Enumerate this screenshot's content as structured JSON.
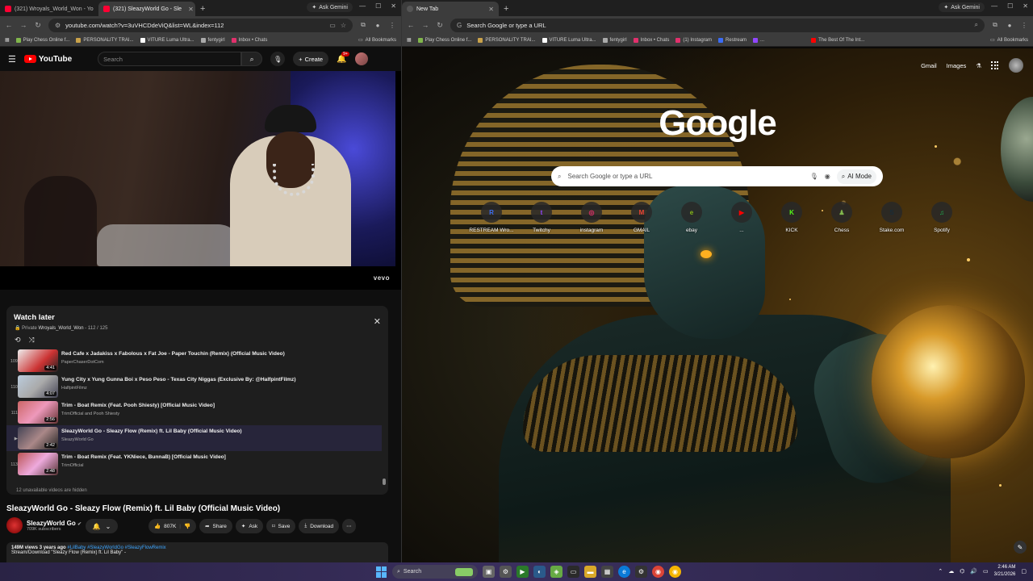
{
  "left_browser": {
    "tabs": [
      {
        "label": "(321) Wroyals_World_Won - Yo",
        "active": false
      },
      {
        "label": "(321) SleazyWorld Go - Sle",
        "active": true
      }
    ],
    "ask_gemini": "Ask Gemini",
    "url": "youtube.com/watch?v=3uVHCDdeViQ&list=WL&index=112",
    "bookmarks": [
      "Play Chess Online f...",
      "PERSONALITY TRAI...",
      "VITURE Luma Ultra...",
      "fentygirl",
      "Inbox • Chats"
    ],
    "all_bookmarks": "All Bookmarks"
  },
  "youtube": {
    "logo": "YouTube",
    "search_placeholder": "Search",
    "create_label": "Create",
    "notif_badge": "9+",
    "vevo": "vevo",
    "playlist": {
      "title": "Watch later",
      "privacy": "Private",
      "owner": "Wroyals_World_Won",
      "position": "- 112 / 125",
      "hidden_note": "12 unavailable videos are hidden",
      "items": [
        {
          "index": "109",
          "title": "Red Cafe x Jadakiss x Fabolous x Fat Joe - Paper Touchin (Remix) (Official Music Video)",
          "channel": "PaperChaserDotCom",
          "duration": "4:41",
          "active": false
        },
        {
          "index": "110",
          "title": "Yung City x Yung Gunna Boi x Peso Peso - Texas City Niggas (Exclusive By: @HalfpintFilmz)",
          "channel": "HalfpintFilmz",
          "duration": "4:07",
          "active": false
        },
        {
          "index": "111",
          "title": "Trim - Boat Remix (Feat. Pooh Shiesty) [Official Music Video]",
          "channel": "TrimOfficial and Pooh Shiesty",
          "duration": "2:56",
          "active": false
        },
        {
          "index": "▶",
          "title": "SleazyWorld Go - Sleazy Flow (Remix) ft. Lil Baby (Official Music Video)",
          "channel": "SleazyWorld Go",
          "duration": "2:42",
          "active": true
        },
        {
          "index": "113",
          "title": "Trim - Boat Remix (Feat. YKNiece, BunnaB) [Official Music Video]",
          "channel": "TrimOfficial",
          "duration": "2:48",
          "active": false
        }
      ]
    },
    "video_title": "SleazyWorld Go - Sleazy Flow (Remix) ft. Lil Baby (Official Music Video)",
    "channel_name": "SleazyWorld Go",
    "subscribers": "709K subscribers",
    "likes": "807K",
    "share": "Share",
    "ask": "Ask",
    "save": "Save",
    "download": "Download",
    "views_line": "149M views  3 years ago",
    "tags": "#LilBaby #SleazyWorldGo #SleazyFlowRemix",
    "desc_line": "Stream/Download \"Sleazy Flow (Remix) ft. Lil Baby\" -"
  },
  "right_browser": {
    "tab": "New Tab",
    "ask_gemini": "Ask Gemini",
    "omnibox_placeholder": "Search Google or type a URL",
    "bookmarks": [
      "Play Chess Online f...",
      "PERSONALITY TRAI...",
      "VITURE Luma Ultra...",
      "fentygirl",
      "Inbox • Chats",
      "(1) Instagram",
      "Restream",
      "...",
      "The Best Of The Int..."
    ],
    "all_bookmarks": "All Bookmarks"
  },
  "google": {
    "gmail": "Gmail",
    "images": "Images",
    "logo": "Google",
    "search_placeholder": "Search Google or type a URL",
    "ai_mode": "AI Mode",
    "shortcuts": [
      {
        "label": "RESTREAM Wro...",
        "glyph": "R",
        "color": "#3b6cf5"
      },
      {
        "label": "Twitchy",
        "glyph": "t",
        "color": "#9146ff"
      },
      {
        "label": "instagram",
        "glyph": "◎",
        "color": "#e1306c"
      },
      {
        "label": "GMAIL",
        "glyph": "M",
        "color": "#ea4335"
      },
      {
        "label": "ebay",
        "glyph": "e",
        "color": "#86b817"
      },
      {
        "label": "...",
        "glyph": "▶",
        "color": "#ff0000"
      },
      {
        "label": "KICK",
        "glyph": "K",
        "color": "#53fc18"
      },
      {
        "label": "Chess",
        "glyph": "♟",
        "color": "#81b64c"
      },
      {
        "label": "Stake.com",
        "glyph": "S",
        "color": "#1a2c38"
      },
      {
        "label": "Spotify",
        "glyph": "♫",
        "color": "#1db954"
      }
    ]
  },
  "taskbar": {
    "search": "Search",
    "time": "2:46 AM",
    "date": "3/21/2026"
  }
}
